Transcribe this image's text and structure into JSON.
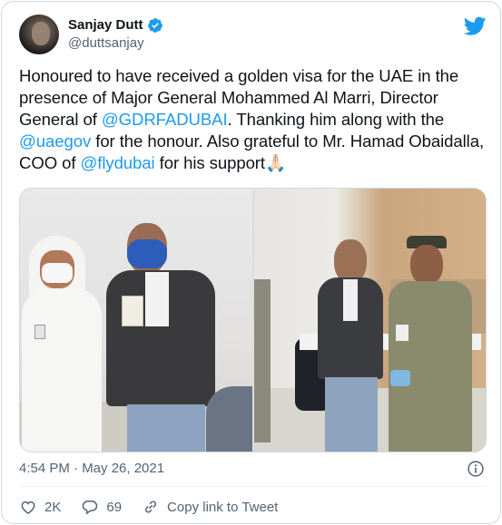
{
  "tweet": {
    "author": {
      "display_name": "Sanjay Dutt",
      "handle": "@duttsanjay",
      "verified": true
    },
    "text_segments": [
      {
        "text": "Honoured to have received a golden visa for the UAE in the presence of Major General Mohammed Al Marri, Director General of ",
        "type": "plain"
      },
      {
        "text": "@GDRFADUBAI",
        "type": "mention"
      },
      {
        "text": ". Thanking him along with the ",
        "type": "plain"
      },
      {
        "text": "@uaegov",
        "type": "mention"
      },
      {
        "text": " for the honour. Also grateful to Mr. Hamad Obaidalla, COO of ",
        "type": "plain"
      },
      {
        "text": "@flydubai",
        "type": "mention"
      },
      {
        "text": " for his support",
        "type": "plain"
      },
      {
        "text": "🙏🏻",
        "type": "emoji"
      }
    ],
    "timestamp": "4:54 PM · May 26, 2021",
    "actions": {
      "likes": "2K",
      "replies": "69",
      "copy_link_label": "Copy link to Tweet"
    }
  },
  "colors": {
    "accent": "#1d9bf0",
    "text": "#0f1419",
    "secondary": "#536471",
    "border": "#cfd9de"
  },
  "icons": [
    "verified-badge-icon",
    "twitter-bird-icon",
    "info-icon",
    "heart-icon",
    "reply-icon",
    "link-icon"
  ]
}
